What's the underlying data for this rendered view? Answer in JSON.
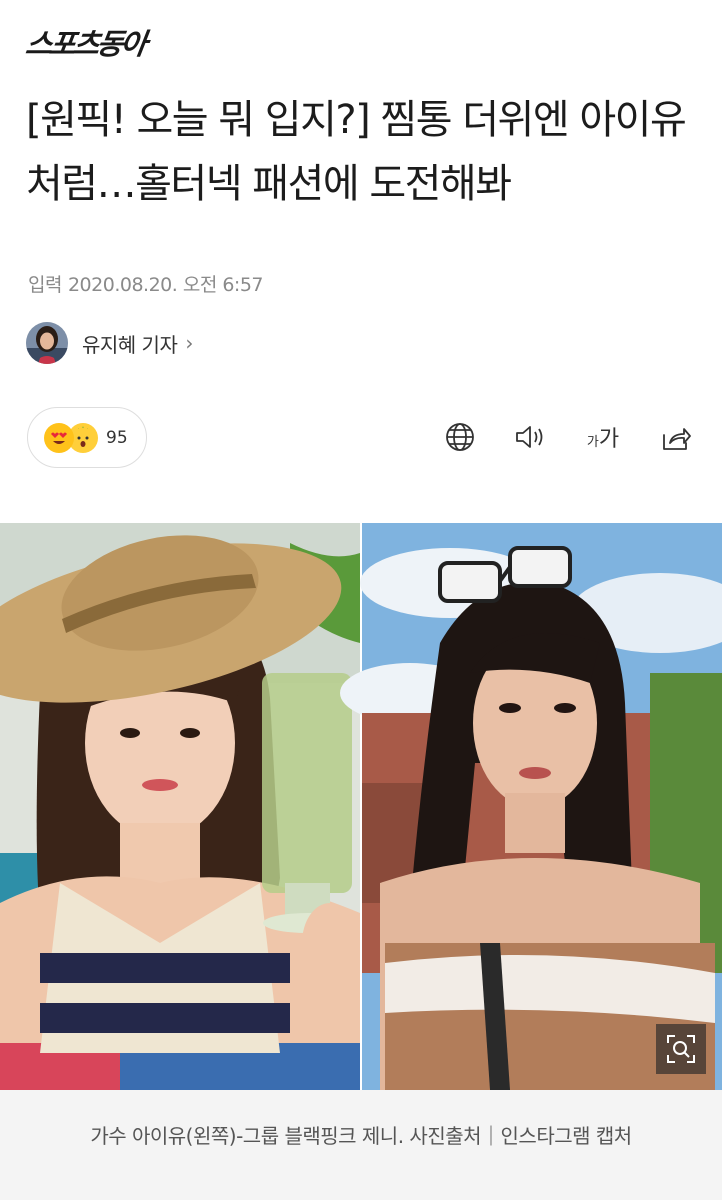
{
  "header": {
    "logo_text": "스포츠동아"
  },
  "article": {
    "title": "[원픽! 오늘 뭐 입지?] 찜통 더위엔 아이유처럼…홀터넥 패션에 도전해봐",
    "input_label": "입력",
    "input_datetime": "2020.08.20. 오전 6:57",
    "author": {
      "name": "유지혜 기자",
      "chevron": "›"
    }
  },
  "toolbar": {
    "reaction_count": "95",
    "reaction_icons": [
      "heart-eyes-emoji-icon",
      "surprised-pineapple-emoji-icon"
    ],
    "font_small": "가",
    "font_large": "가",
    "icons": [
      "globe-icon",
      "speaker-icon",
      "font-size-icon",
      "share-icon"
    ]
  },
  "photo": {
    "caption": "가수 아이유(왼쪽)-그룹 블랙핑크 제니. 사진출처｜인스타그램 캡처",
    "zoom_icon": "magnifier-zoom-icon"
  }
}
